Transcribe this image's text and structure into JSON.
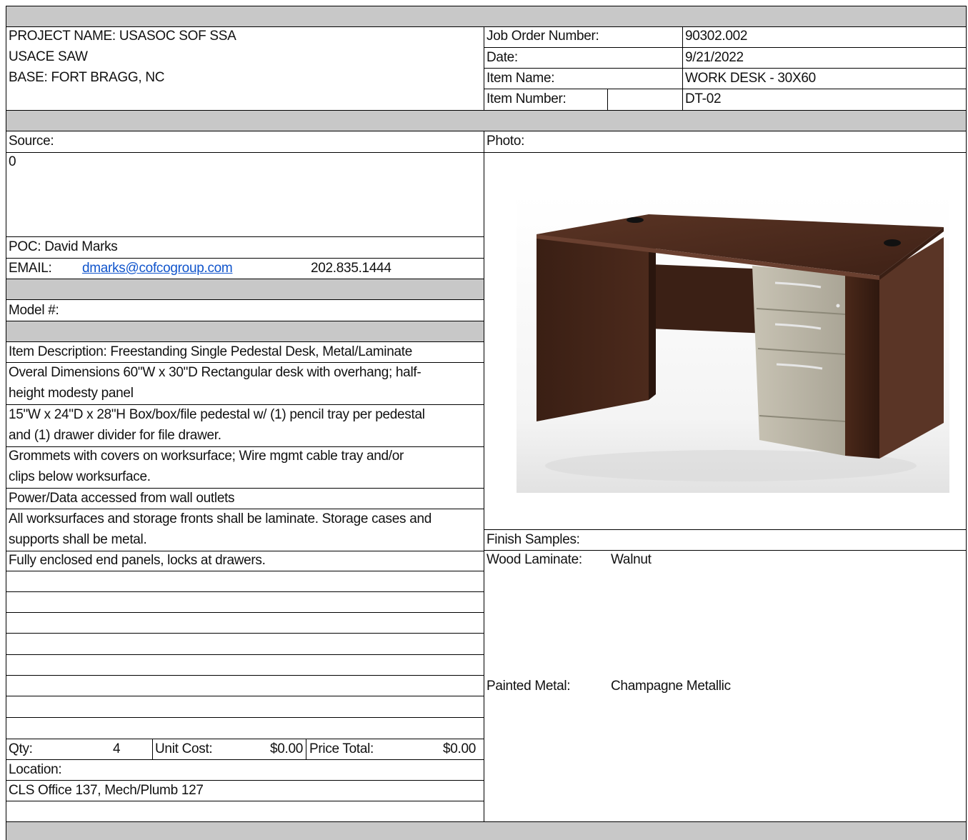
{
  "header": {
    "project_name": "PROJECT NAME: USASOC SOF SSA",
    "agency": "USACE SAW",
    "base": "BASE: FORT BRAGG, NC"
  },
  "meta": {
    "job_order_label": "Job Order Number:",
    "job_order_value": "90302.002",
    "date_label": "Date:",
    "date_value": "9/21/2022",
    "item_name_label": "Item Name:",
    "item_name_value": "WORK DESK - 30X60",
    "item_number_label": "Item Number:",
    "item_number_value": "DT-02"
  },
  "source": {
    "label": "Source:",
    "value": "0",
    "poc": "POC: David Marks",
    "email_label": "EMAIL:",
    "email": "dmarks@cofcogroup.com",
    "phone": "202.835.1444"
  },
  "model": {
    "label": "Model #:"
  },
  "description": [
    "Item Description: Freestanding Single Pedestal Desk, Metal/Laminate",
    "Overal Dimensions 60\"W x 30\"D Rectangular desk with overhang; half-",
    "height modesty panel",
    "15\"W x 24\"D x 28\"H Box/box/file pedestal w/ (1) pencil tray per pedestal",
    "and (1) drawer divider for file drawer.",
    "Grommets with covers on worksurface; Wire mgmt cable tray and/or",
    "clips below worksurface.",
    "Power/Data accessed from wall outlets",
    "All worksurfaces and storage fronts shall be laminate. Storage cases and",
    "supports shall be metal.",
    "Fully enclosed end panels, locks at drawers."
  ],
  "pricing": {
    "qty_label": "Qty:",
    "qty_value": "4",
    "unit_cost_label": "Unit Cost:",
    "unit_cost_value": "$0.00",
    "price_total_label": "Price Total:",
    "price_total_value": "$0.00"
  },
  "location": {
    "label": "Location:",
    "value": "CLS Office 137, Mech/Plumb 127"
  },
  "photo": {
    "label": "Photo:"
  },
  "finish": {
    "label": "Finish Samples:",
    "wood_label": "Wood Laminate:",
    "wood_value": "Walnut",
    "metal_label": "Painted Metal:",
    "metal_value": "Champagne Metallic"
  },
  "colors": {
    "grey_band": "#c8c8c8",
    "walnut": "#4a2a1c",
    "champagne": "#b9b4a4",
    "link": "#1155cc"
  }
}
